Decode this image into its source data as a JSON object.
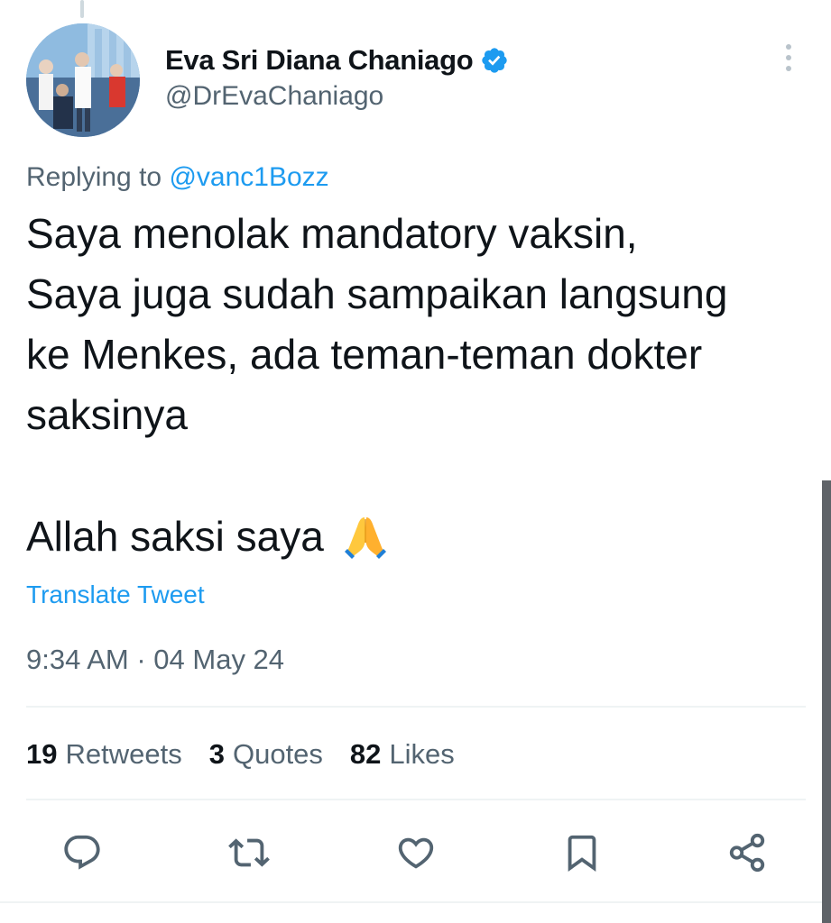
{
  "author": {
    "display_name": "Eva Sri Diana Chaniago",
    "handle": "@DrEvaChaniago",
    "verified": true
  },
  "reply": {
    "prefix": "Replying to",
    "mention": "@vanc1Bozz"
  },
  "tweet": {
    "lines": [
      "Saya menolak mandatory vaksin,",
      "Saya juga sudah sampaikan langsung",
      "ke Menkes, ada teman-teman dokter",
      "saksinya"
    ],
    "closing": "Allah saksi saya",
    "emoji": "folded-hands"
  },
  "translate_label": "Translate Tweet",
  "timestamp": "9:34 AM · 04 May 24",
  "stats": [
    {
      "count": "19",
      "label": "Retweets"
    },
    {
      "count": "3",
      "label": "Quotes"
    },
    {
      "count": "82",
      "label": "Likes"
    }
  ],
  "actions": [
    {
      "icon": "reply-icon"
    },
    {
      "icon": "retweet-icon"
    },
    {
      "icon": "like-icon"
    },
    {
      "icon": "bookmark-icon"
    },
    {
      "icon": "share-icon"
    }
  ],
  "colors": {
    "accent": "#1d9bf0",
    "text": "#0f1419",
    "secondary_text": "#536471",
    "divider": "#eff3f4"
  }
}
